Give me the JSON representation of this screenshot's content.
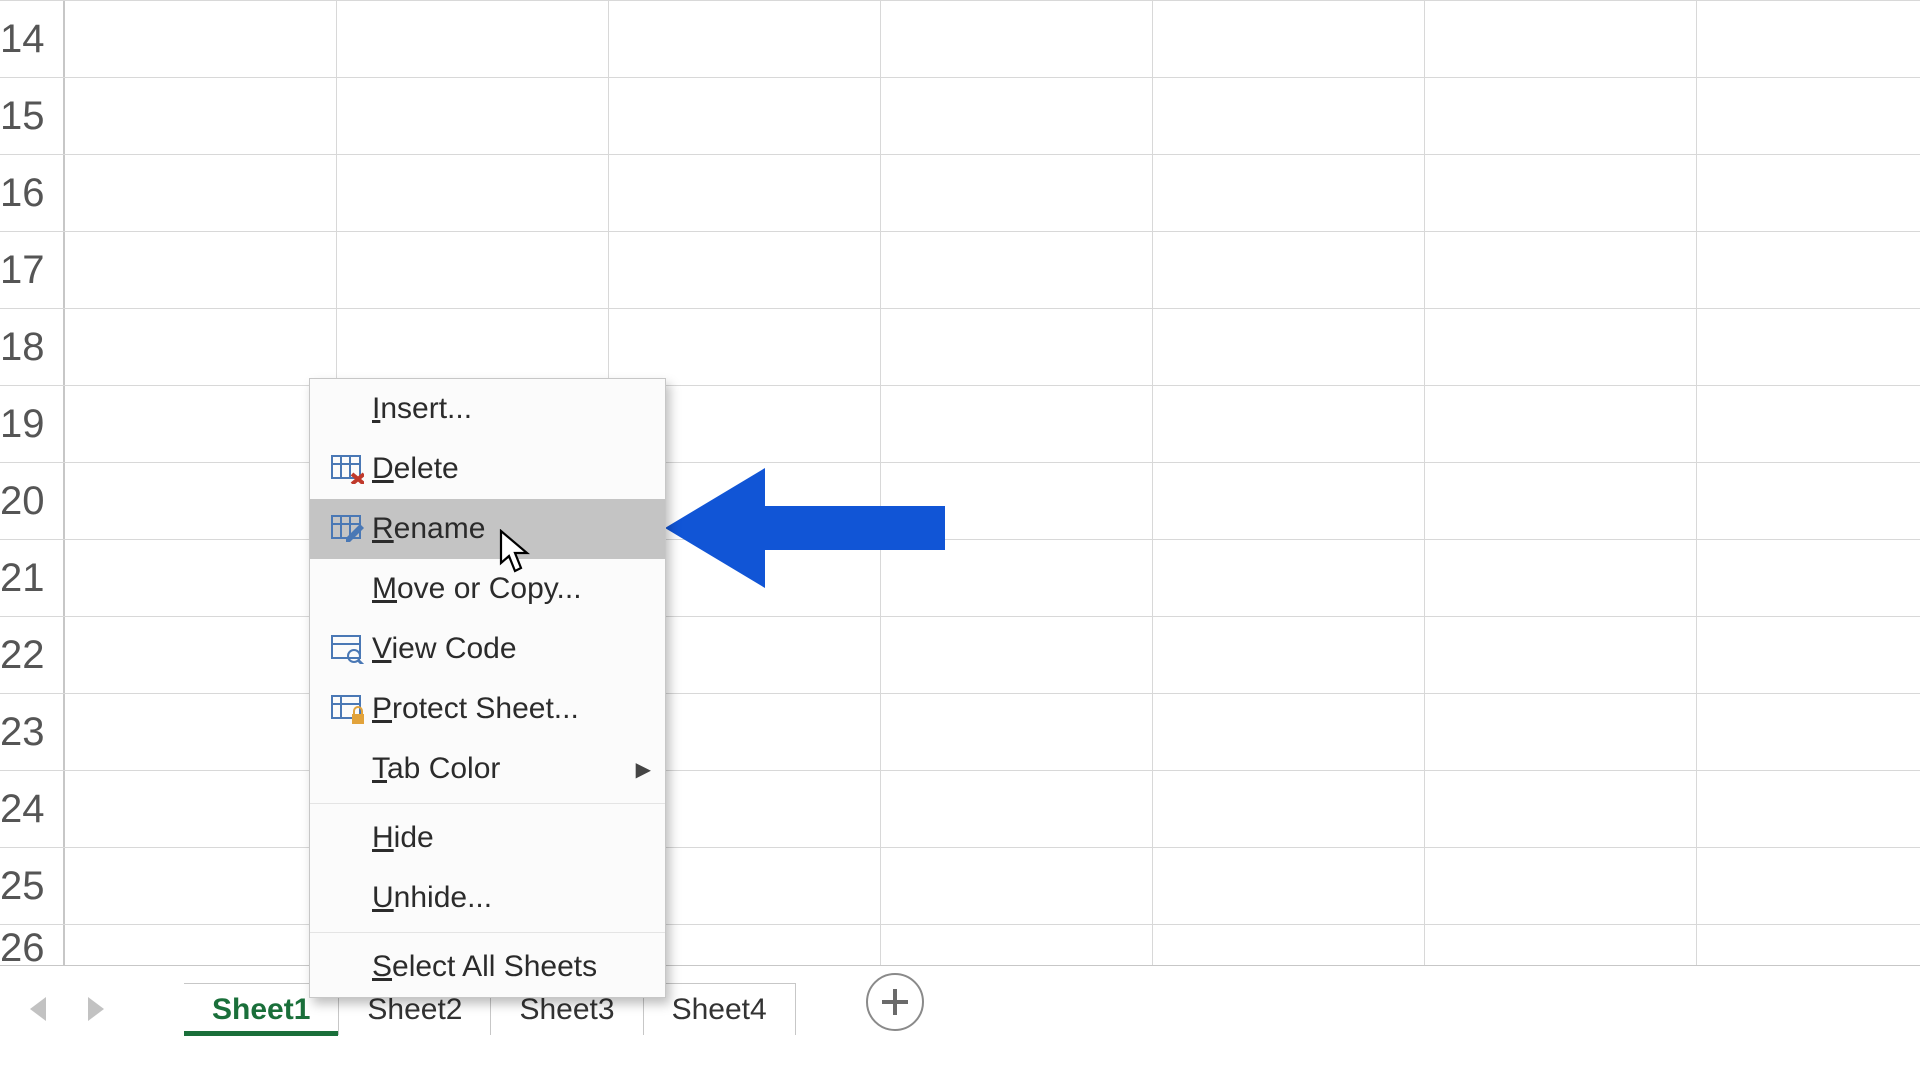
{
  "row_headers": [
    "14",
    "15",
    "16",
    "17",
    "18",
    "19",
    "20",
    "21",
    "22",
    "23",
    "24",
    "25",
    "26"
  ],
  "context_menu": {
    "items": [
      {
        "label_pre": "",
        "u": "I",
        "label_post": "nsert...",
        "icon": null,
        "hover": false,
        "submenu": false
      },
      {
        "label_pre": "",
        "u": "D",
        "label_post": "elete",
        "icon": "delete",
        "hover": false,
        "submenu": false
      },
      {
        "label_pre": "",
        "u": "R",
        "label_post": "ename",
        "icon": "rename",
        "hover": true,
        "submenu": false
      },
      {
        "label_pre": "",
        "u": "M",
        "label_post": "ove or Copy...",
        "icon": null,
        "hover": false,
        "submenu": false
      },
      {
        "label_pre": "",
        "u": "V",
        "label_post": "iew Code",
        "icon": "viewcode",
        "hover": false,
        "submenu": false
      },
      {
        "label_pre": "",
        "u": "P",
        "label_post": "rotect Sheet...",
        "icon": "protect",
        "hover": false,
        "submenu": false
      },
      {
        "label_pre": "",
        "u": "T",
        "label_post": "ab Color",
        "icon": null,
        "hover": false,
        "submenu": true
      },
      {
        "label_pre": "",
        "u": "H",
        "label_post": "ide",
        "icon": null,
        "hover": false,
        "submenu": false,
        "separator_before": true
      },
      {
        "label_pre": "",
        "u": "U",
        "label_post": "nhide...",
        "icon": null,
        "hover": false,
        "submenu": false
      },
      {
        "label_pre": "",
        "u": "S",
        "label_post": "elect All Sheets",
        "icon": null,
        "hover": false,
        "submenu": false,
        "separator_before": true
      }
    ]
  },
  "sheet_tabs": {
    "tabs": [
      {
        "label": "Sheet1",
        "active": true
      },
      {
        "label": "Sheet2",
        "active": false
      },
      {
        "label": "Sheet3",
        "active": false
      },
      {
        "label": "Sheet4",
        "active": false
      }
    ]
  },
  "annotation": {
    "arrow_color": "#1155d6"
  }
}
